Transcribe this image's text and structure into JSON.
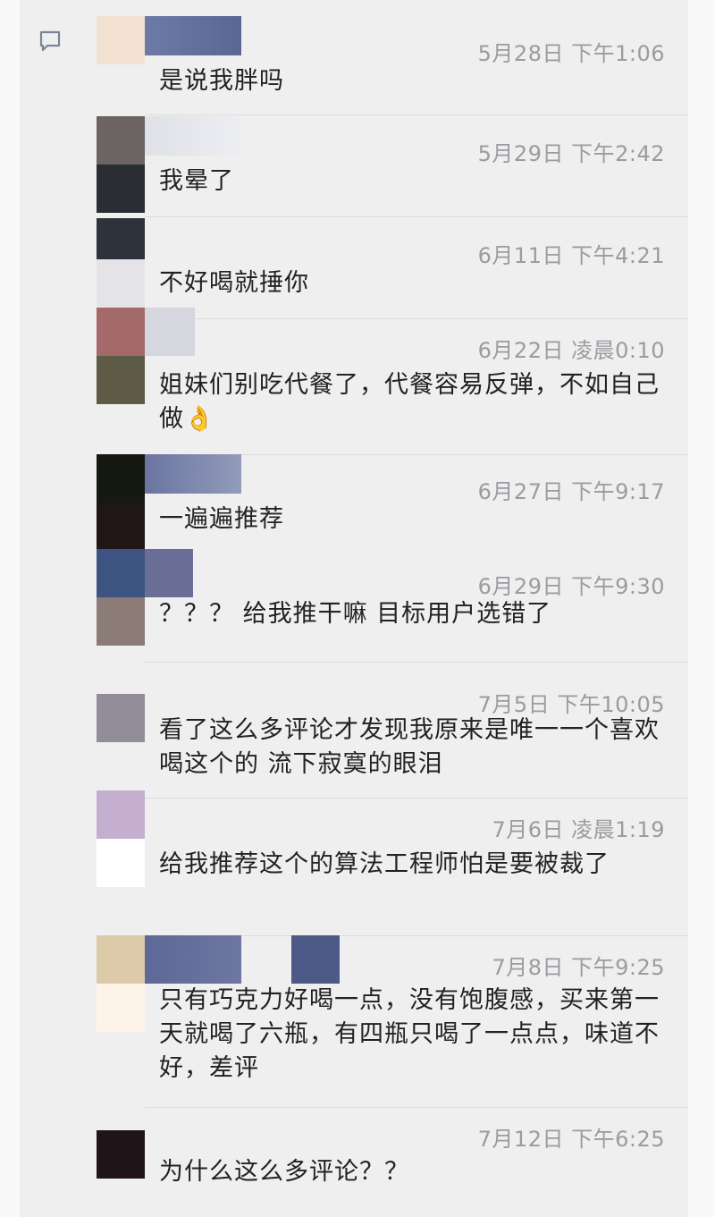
{
  "comments": [
    {
      "time": "5月28日 下午1:06",
      "text": "是说我胖吗"
    },
    {
      "time": "5月29日 下午2:42",
      "text": "我晕了"
    },
    {
      "time": "6月11日 下午4:21",
      "text": "不好喝就捶你"
    },
    {
      "time": "6月22日 凌晨0:10",
      "text": "姐妹们别吃代餐了，代餐容易反弹，不如自己做",
      "emoji": "👌"
    },
    {
      "time": "6月27日 下午9:17",
      "text": "一遍遍推荐"
    },
    {
      "time": "6月29日 下午9:30",
      "text": "？？？ 给我推干嘛 目标用户选错了"
    },
    {
      "time": "7月5日 下午10:05",
      "text": "看了这么多评论才发现我原来是唯一一个喜欢喝这个的 流下寂寞的眼泪"
    },
    {
      "time": "7月6日 凌晨1:19",
      "text": "给我推荐这个的算法工程师怕是要被裁了"
    },
    {
      "time": "7月8日 下午9:25",
      "text": "只有巧克力好喝一点，没有饱腹感，买来第一天就喝了六瓶，有四瓶只喝了一点点，味道不好，差评"
    },
    {
      "time": "7月12日 下午6:25",
      "text": "为什么这么多评论？？"
    }
  ],
  "icons": {
    "comment": "comment-icon"
  },
  "colors": {
    "time": "#9b9ba0",
    "text": "#222222",
    "background": "#efeff0"
  }
}
